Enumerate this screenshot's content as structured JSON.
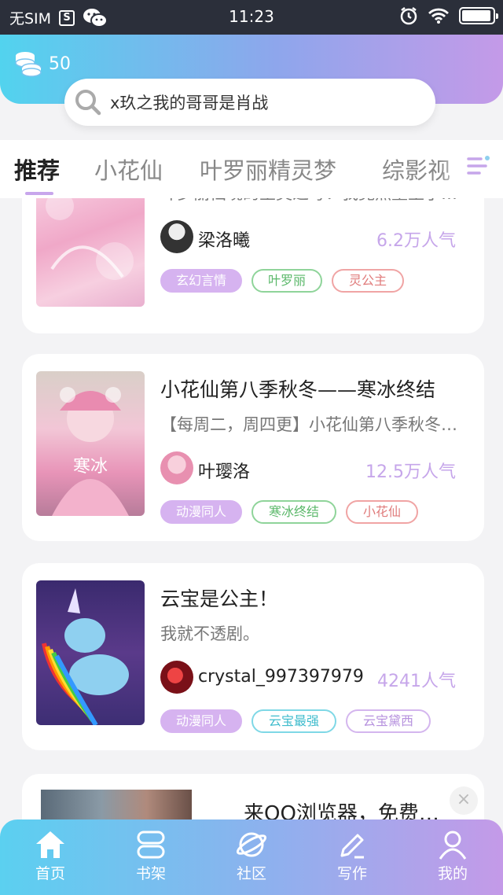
{
  "status_bar": {
    "carrier": "无SIM",
    "s_icon": "S",
    "time": "11:23",
    "battery_level": 0.95
  },
  "header": {
    "coins": "50",
    "search_placeholder": "x玖之我的哥哥是肖战"
  },
  "tabs": [
    "推荐",
    "小花仙",
    "叶罗丽精灵梦",
    "综影视"
  ],
  "cards": [
    {
      "title": "",
      "desc": "叶罗丽仙境的圣灵之母：我竟然重生了…",
      "author": "梁洛曦",
      "popularity": "6.2万人气",
      "tags": [
        "玄幻言情",
        "叶罗丽",
        "灵公主"
      ]
    },
    {
      "title": "小花仙第八季秋冬——寒冰终结",
      "desc": "【每周二，周四更】小花仙第八季秋冬…",
      "author": "叶璎洛",
      "popularity": "12.5万人气",
      "tags": [
        "动漫同人",
        "寒冰终结",
        "小花仙"
      ]
    },
    {
      "title": "云宝是公主！",
      "desc": "我就不透剧。",
      "author": "crystal_997397979",
      "popularity": "4241人气",
      "tags": [
        "动漫同人",
        "云宝最强",
        "云宝黛西"
      ]
    }
  ],
  "ad": {
    "title": "来QQ浏览器，免费…",
    "close": "×"
  },
  "bottom_nav": [
    "首页",
    "书架",
    "社区",
    "写作",
    "我的"
  ],
  "colors": {
    "accent_purple": "#c6a6ea",
    "gradient_start": "#52d3ee",
    "gradient_end": "#c49ae8"
  }
}
